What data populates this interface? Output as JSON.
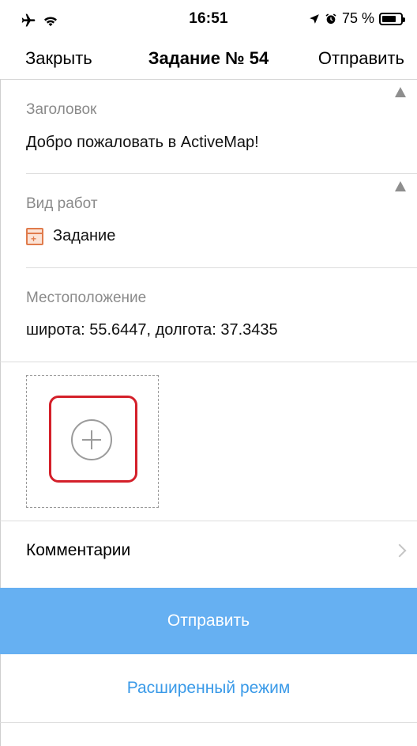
{
  "status_bar": {
    "time": "16:51",
    "battery_text": "75 %",
    "icons": [
      "airplane-icon",
      "wifi-icon",
      "location-arrow-icon",
      "alarm-icon",
      "battery-icon"
    ]
  },
  "nav": {
    "close_label": "Закрыть",
    "title": "Задание № 54",
    "send_label": "Отправить"
  },
  "form": {
    "title_field": {
      "label": "Заголовок",
      "value": "Добро пожаловать в ActiveMap!",
      "icon": "warning-icon"
    },
    "work_type_field": {
      "label": "Вид работ",
      "value": "Задание",
      "icon": "task-type-icon"
    },
    "location_field": {
      "label": "Местоположение",
      "value": "широта: 55.6447, долгота: 37.3435"
    },
    "photo": {
      "icon": "add-photo-icon"
    },
    "comments_label": "Комментарии"
  },
  "actions": {
    "submit_label": "Отправить",
    "advanced_label": "Расширенный режим"
  },
  "colors": {
    "accent_blue": "#66b0f2",
    "link_blue": "#3a9ae8",
    "highlight_red": "#d4202a",
    "task_icon_orange": "#e07b4c"
  }
}
